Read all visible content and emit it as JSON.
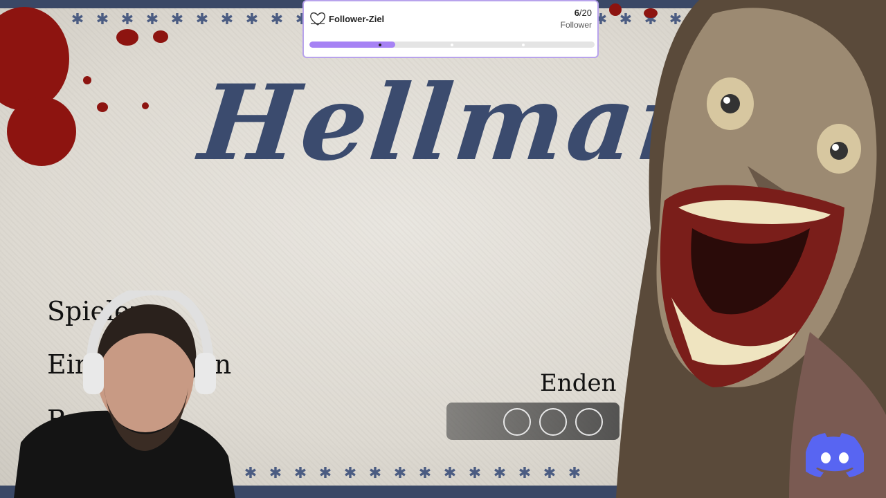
{
  "game": {
    "title": "Hellmart",
    "menu": [
      "Spielen",
      "Einstellungen",
      "Beenden"
    ],
    "endings_label": "Enden",
    "endings_slots": 3
  },
  "follower_goal": {
    "label": "Follower-Ziel",
    "current": "6",
    "target": "/20",
    "unit": "Follower",
    "progress": 0.3
  },
  "colors": {
    "title": "#3b4b6e",
    "accent": "#a682f4",
    "blood": "#8d1410",
    "discord": "#5865f2"
  },
  "icons": {
    "goal": "heart-outline-icon",
    "discord": "discord-icon",
    "separator": "asterisk-icon"
  }
}
